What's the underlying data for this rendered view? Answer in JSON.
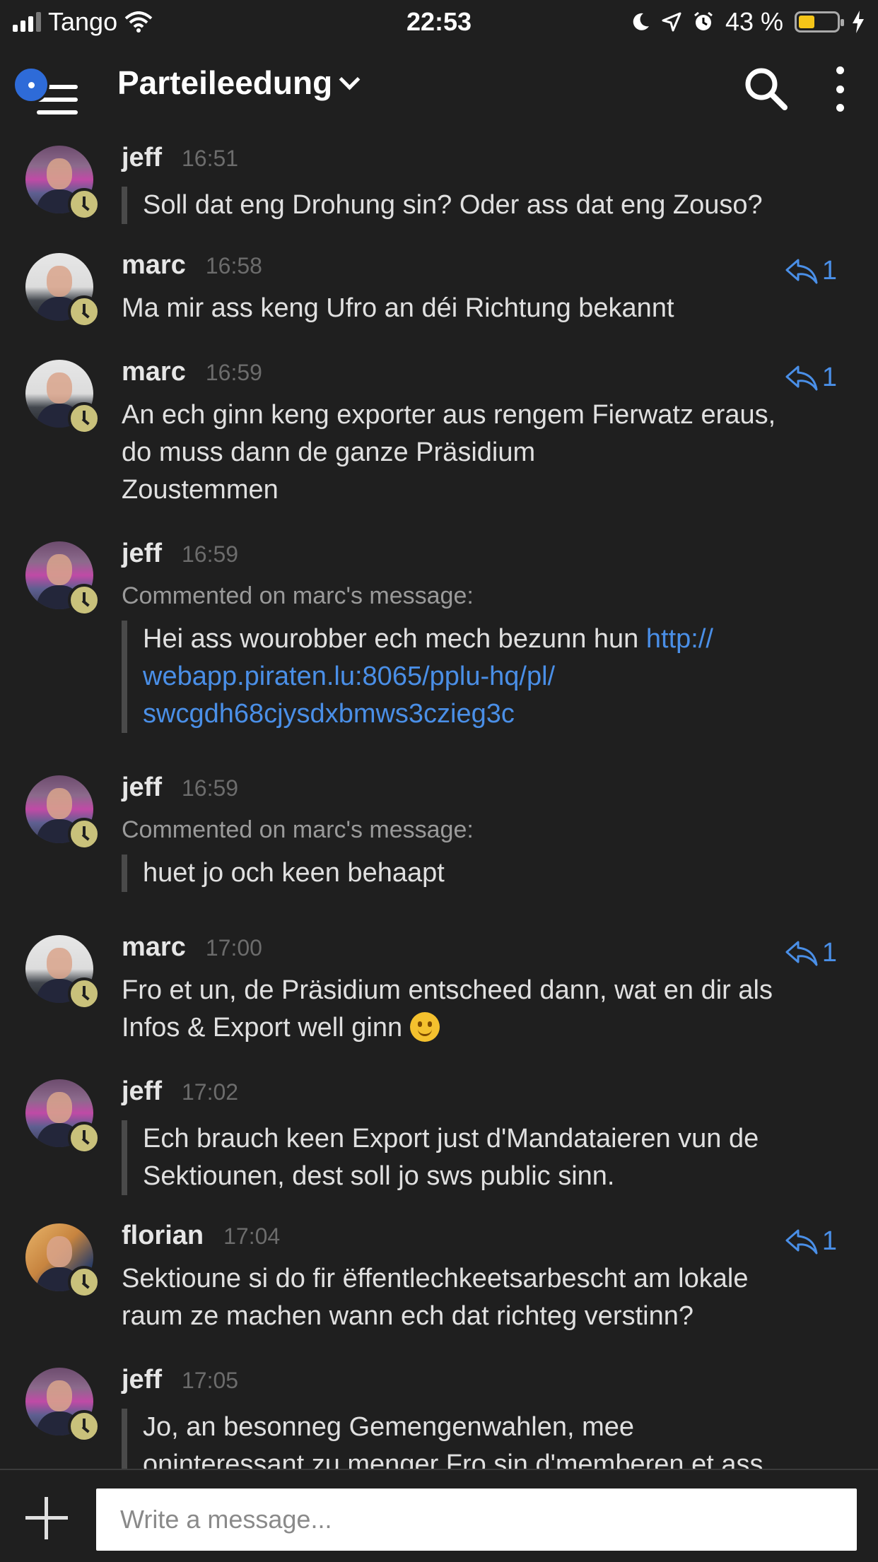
{
  "status_bar": {
    "carrier": "Tango",
    "time": "22:53",
    "battery_percent": "43 %",
    "battery_level": 0.43
  },
  "header": {
    "channel_name": "Parteileedung"
  },
  "messages": [
    {
      "user": "jeff",
      "time": "16:51",
      "kind": "quote",
      "text": "Soll dat eng Drohung sin? Oder ass dat eng Zouso?"
    },
    {
      "user": "marc",
      "time": "16:58",
      "kind": "plain",
      "reply_count": "1",
      "text": "Ma mir ass keng Ufro an déi Richtung bekannt"
    },
    {
      "user": "marc",
      "time": "16:59",
      "kind": "plain",
      "reply_count": "1",
      "text_lines": [
        "An ech ginn keng exporter aus rengem Fierwatz eraus,",
        "do muss dann de ganze Präsidium",
        "Zoustemmen"
      ]
    },
    {
      "user": "jeff",
      "time": "16:59",
      "kind": "comment",
      "commented": "Commented on marc's message:",
      "text": "Hei ass wourobber ech mech bezunn hun",
      "link_lines": [
        "http://",
        "webapp.piraten.lu:8065/pplu-hq/pl/",
        "swcgdh68cjysdxbmws3czieg3c"
      ]
    },
    {
      "user": "jeff",
      "time": "16:59",
      "kind": "comment",
      "commented": "Commented on marc's message:",
      "text": "huet jo och keen behaapt"
    },
    {
      "user": "marc",
      "time": "17:00",
      "kind": "plain",
      "reply_count": "1",
      "text_lines": [
        "Fro et un, de Präsidium entscheed dann, wat en dir als",
        "Infos & Export well ginn"
      ]
    },
    {
      "user": "jeff",
      "time": "17:02",
      "kind": "quote",
      "text_lines": [
        "Ech brauch keen Export just d'Mandataieren vun de",
        "Sektiounen, dest soll jo sws public sinn."
      ]
    },
    {
      "user": "florian",
      "time": "17:04",
      "kind": "plain",
      "reply_count": "1",
      "text_lines": [
        "Sektioune si do fir ëffentlechkeetsarbescht am lokale",
        "raum ze machen wann ech dat richteg verstinn?"
      ]
    },
    {
      "user": "jeff",
      "time": "17:05",
      "kind": "quote",
      "text_lines": [
        "Jo, an besonneg Gemengenwahlen, mee",
        "oninteressant zu menger Fro sin d'memberen et ass"
      ]
    }
  ],
  "composer": {
    "placeholder": "Write a message..."
  },
  "icons": {
    "emoji": "slightly-smiling-face",
    "reply": "reply-arrow-icon",
    "status": "clock-icon"
  },
  "colors": {
    "background": "#1f1f1f",
    "link": "#4a8fe7",
    "notification": "#2e6bd8",
    "status_clock": "#c9c17b"
  }
}
